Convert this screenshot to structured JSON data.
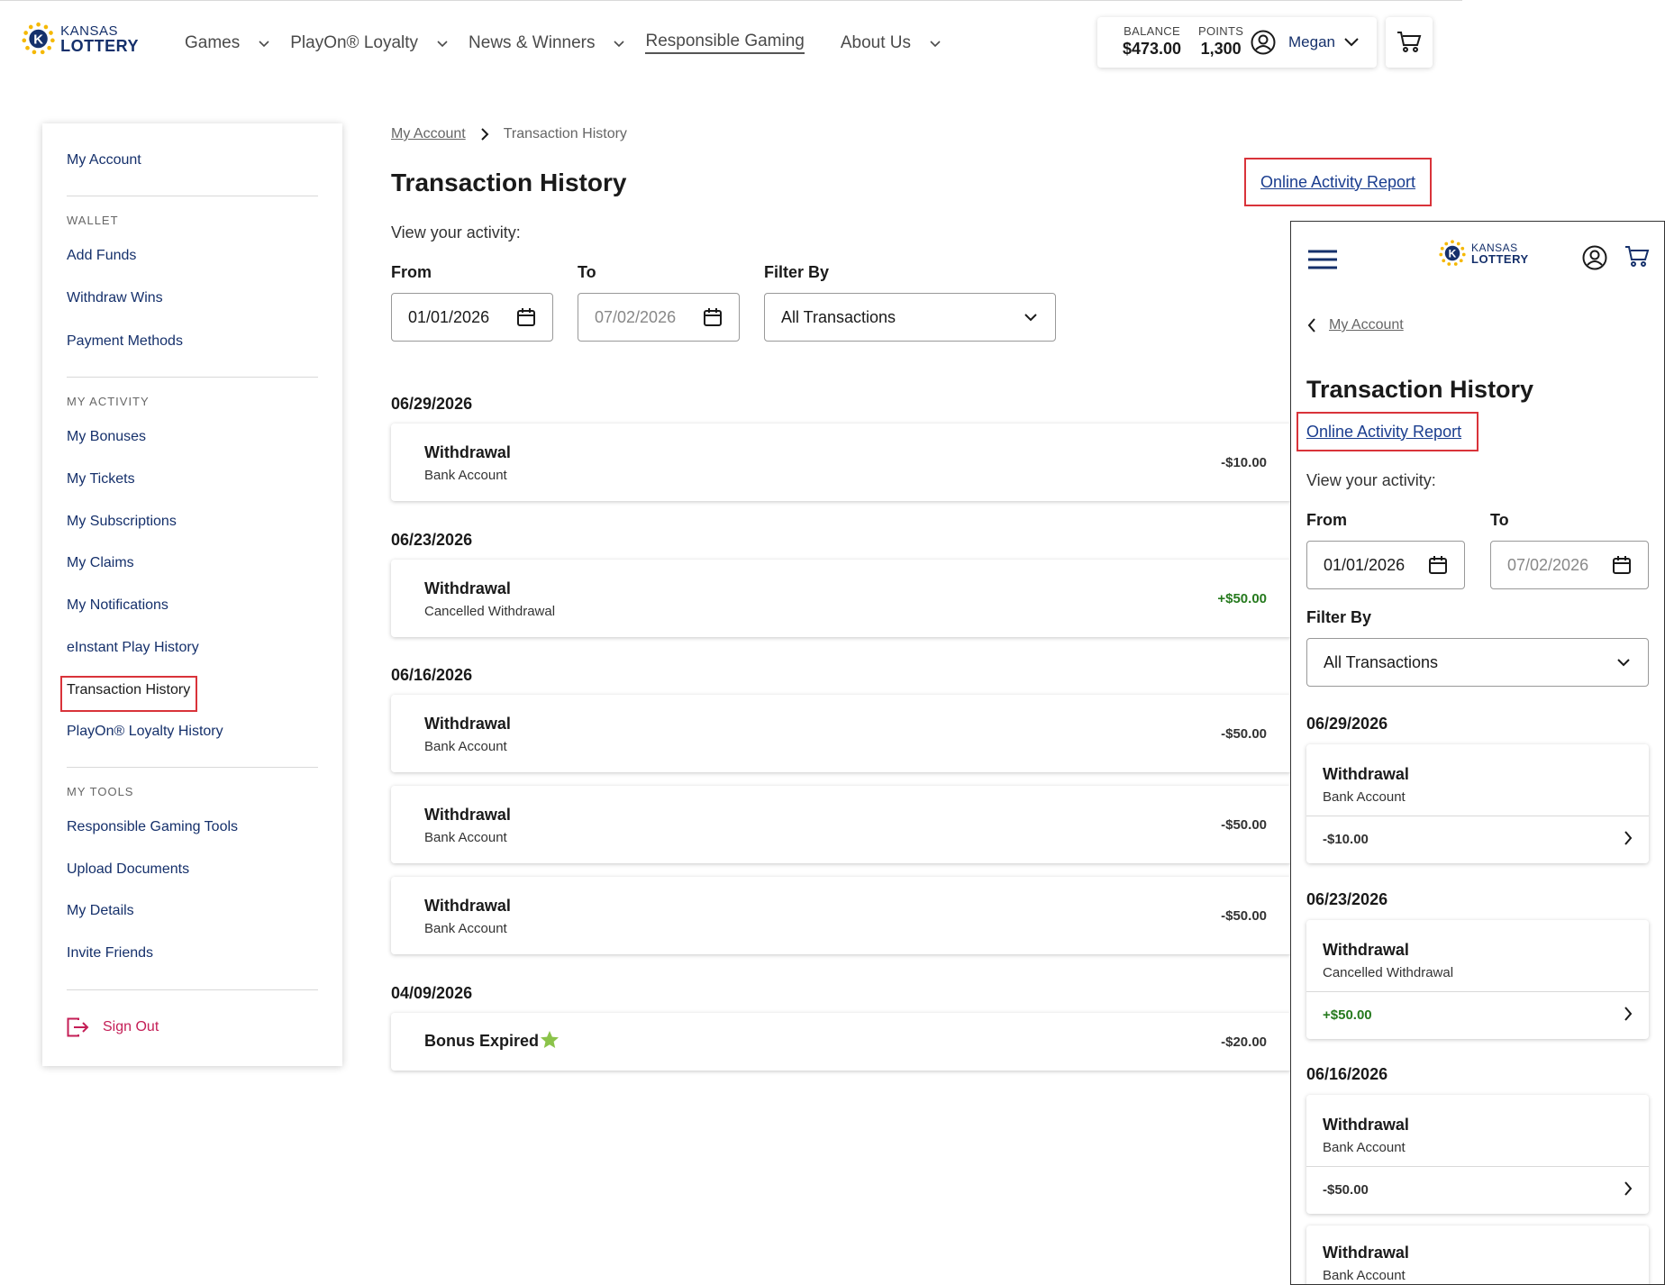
{
  "brand": {
    "line1": "KANSAS",
    "line2": "LOTTERY"
  },
  "nav": [
    {
      "label": "Games",
      "dropdown": true
    },
    {
      "label": "PlayOn® Loyalty",
      "dropdown": true
    },
    {
      "label": "News & Winners",
      "dropdown": true
    },
    {
      "label": "Responsible Gaming",
      "dropdown": false
    },
    {
      "label": "About Us",
      "dropdown": true
    }
  ],
  "account": {
    "balance_label": "BALANCE",
    "balance_value": "$473.00",
    "points_label": "POINTS",
    "points_value": "1,300",
    "user_name": "Megan"
  },
  "sidebar": {
    "top_link": "My Account",
    "wallet_heading": "WALLET",
    "wallet": [
      "Add Funds",
      "Withdraw Wins",
      "Payment Methods"
    ],
    "activity_heading": "MY ACTIVITY",
    "activity": [
      "My Bonuses",
      "My Tickets",
      "My Subscriptions",
      "My Claims",
      "My Notifications",
      "eInstant Play History",
      "Transaction History",
      "PlayOn® Loyalty History"
    ],
    "tools_heading": "MY TOOLS",
    "tools": [
      "Responsible Gaming Tools",
      "Upload Documents",
      "My Details",
      "Invite Friends"
    ],
    "sign_out": "Sign Out"
  },
  "main": {
    "breadcrumb_parent": "My Account",
    "breadcrumb_current": "Transaction History",
    "title": "Transaction History",
    "report_link": "Online Activity Report",
    "view_label": "View your activity:",
    "from_label": "From",
    "from_value": "01/01/2026",
    "to_label": "To",
    "to_value": "07/02/2026",
    "filter_label": "Filter By",
    "filter_value": "All Transactions",
    "groups": [
      {
        "date": "06/29/2026",
        "items": [
          {
            "title": "Withdrawal",
            "sub": "Bank Account",
            "amount": "-$10.00",
            "positive": false
          }
        ]
      },
      {
        "date": "06/23/2026",
        "items": [
          {
            "title": "Withdrawal",
            "sub": "Cancelled Withdrawal",
            "amount": "+$50.00",
            "positive": true
          }
        ]
      },
      {
        "date": "06/16/2026",
        "items": [
          {
            "title": "Withdrawal",
            "sub": "Bank Account",
            "amount": "-$50.00",
            "positive": false
          },
          {
            "title": "Withdrawal",
            "sub": "Bank Account",
            "amount": "-$50.00",
            "positive": false
          },
          {
            "title": "Withdrawal",
            "sub": "Bank Account",
            "amount": "-$50.00",
            "positive": false
          }
        ]
      },
      {
        "date": "04/09/2026",
        "items": [
          {
            "title": "Bonus Expired",
            "sub": "",
            "amount": "-$20.00",
            "positive": false,
            "star": true
          }
        ]
      }
    ]
  },
  "mobile": {
    "back_label": "My Account",
    "title": "Transaction History",
    "report_link": "Online Activity Report",
    "view_label": "View your activity:",
    "from_label": "From",
    "from_value": "01/01/2026",
    "to_label": "To",
    "to_value": "07/02/2026",
    "filter_label": "Filter By",
    "filter_value": "All Transactions",
    "groups": [
      {
        "date": "06/29/2026",
        "items": [
          {
            "title": "Withdrawal",
            "sub": "Bank Account",
            "amount": "-$10.00",
            "positive": false
          }
        ]
      },
      {
        "date": "06/23/2026",
        "items": [
          {
            "title": "Withdrawal",
            "sub": "Cancelled Withdrawal",
            "amount": "+$50.00",
            "positive": true
          }
        ]
      },
      {
        "date": "06/16/2026",
        "items": [
          {
            "title": "Withdrawal",
            "sub": "Bank Account",
            "amount": "-$50.00",
            "positive": false
          },
          {
            "title": "Withdrawal",
            "sub": "Bank Account",
            "amount": "",
            "positive": false
          }
        ]
      }
    ]
  },
  "colors": {
    "navy": "#15306b",
    "link": "#1a3d8f",
    "highlight": "#d9333a",
    "positive": "#267a1e",
    "signout": "#c41e56",
    "logo_yellow": "#f5b800"
  }
}
